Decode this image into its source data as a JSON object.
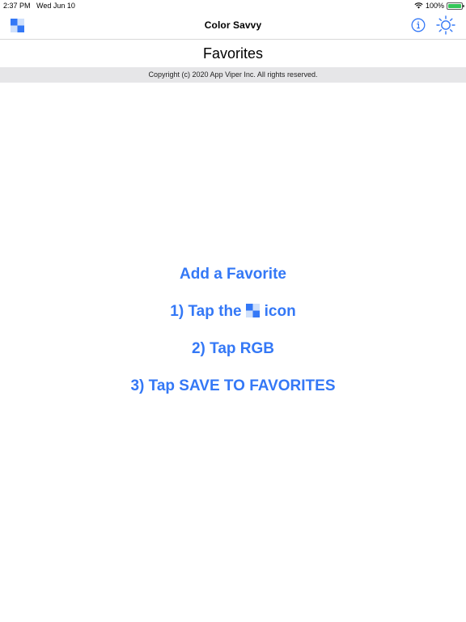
{
  "status_bar": {
    "time": "2:37 PM",
    "date": "Wed Jun 10",
    "battery_percent": "100%",
    "battery_level": 1.0
  },
  "nav": {
    "title": "Color Savvy",
    "left_icon": "color-swatch-icon",
    "right_icons": [
      "info-icon",
      "brightness-icon"
    ]
  },
  "page": {
    "title": "Favorites",
    "copyright": "Copyright (c) 2020 App Viper Inc. All rights reserved."
  },
  "instructions": {
    "heading": "Add a Favorite",
    "step1_before": "1) Tap the",
    "step1_after": "icon",
    "step2": "2) Tap RGB",
    "step3": "3) Tap SAVE TO FAVORITES"
  },
  "colors": {
    "accent": "#3478f6",
    "copyright_bg": "#e6e6e8",
    "battery": "#34c759"
  }
}
